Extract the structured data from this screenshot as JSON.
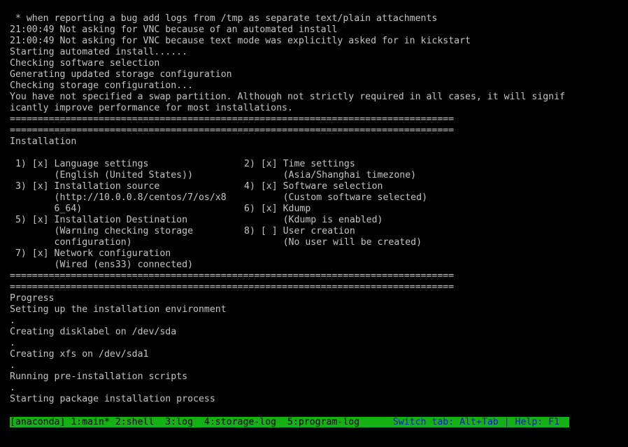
{
  "colors": {
    "background": "#000000",
    "text": "#c4c4c4",
    "statusbar_bg": "#14b014",
    "statusbar_text": "#000000",
    "statusbar_help": "#1616c8"
  },
  "log_lines": [
    " * when reporting a bug add logs from /tmp as separate text/plain attachments",
    "21:00:49 Not asking for VNC because of an automated install",
    "21:00:49 Not asking for VNC because text mode was explicitly asked for in kickstart",
    "Starting automated install......",
    "Checking software selection",
    "Generating updated storage configuration",
    "Checking storage configuration...",
    "You have not specified a swap partition. Although not strictly required in all cases, it will signif",
    "icantly improve performance for most installations."
  ],
  "separator": "================================================================================",
  "installation": {
    "title": "Installation",
    "rows": [
      {
        "left": " 1) [x] Language settings",
        "right": "2) [x] Time settings"
      },
      {
        "left": "        (English (United States))",
        "right": "       (Asia/Shanghai timezone)"
      },
      {
        "left": " 3) [x] Installation source",
        "right": "4) [x] Software selection"
      },
      {
        "left": "        (http://10.0.0.8/centos/7/os/x8",
        "right": "       (Custom software selected)"
      },
      {
        "left": "        6_64)",
        "right": "6) [x] Kdump"
      },
      {
        "left": " 5) [x] Installation Destination",
        "right": "       (Kdump is enabled)"
      },
      {
        "left": "        (Warning checking storage",
        "right": "8) [ ] User creation"
      },
      {
        "left": "        configuration)",
        "right": "       (No user will be created)"
      },
      {
        "left": " 7) [x] Network configuration",
        "right": ""
      },
      {
        "left": "        (Wired (ens33) connected)",
        "right": ""
      }
    ]
  },
  "progress": {
    "title": "Progress",
    "lines": [
      "Setting up the installation environment",
      ".",
      "Creating disklabel on /dev/sda",
      ".",
      "Creating xfs on /dev/sda1",
      ".",
      "Running pre-installation scripts",
      ".",
      "Starting package installation process"
    ]
  },
  "statusbar": {
    "tabs": "[anaconda] 1:main* 2:shell  3:log  4:storage-log  5:program-log      ",
    "help": "Switch tab: Alt+Tab | Help: F1 "
  }
}
